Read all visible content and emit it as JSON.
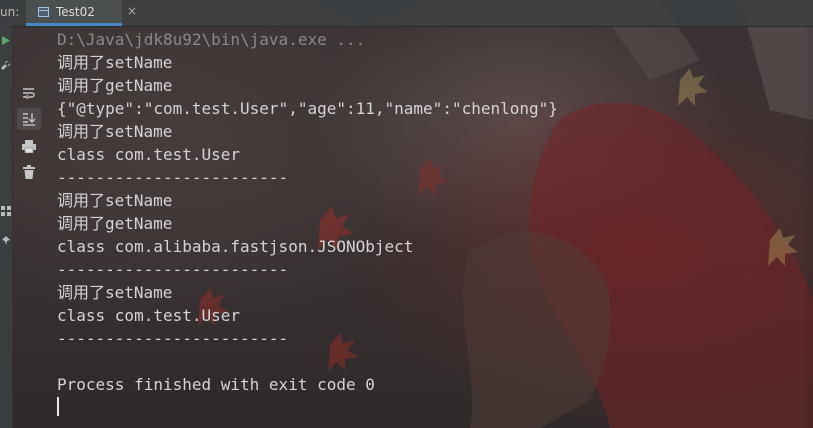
{
  "run_panel": {
    "label": "un:",
    "tab": {
      "label": "Test02",
      "close": "×"
    }
  },
  "toolbar": {
    "tools": [
      {
        "name": "soft-wrap-icon"
      },
      {
        "name": "scroll-to-end-icon",
        "active": true
      },
      {
        "name": "print-icon"
      },
      {
        "name": "trash-icon"
      }
    ],
    "gutter_icons": [
      "run-icon",
      "wrench-icon",
      "layout-icon",
      "pin-icon"
    ]
  },
  "console": {
    "lines": [
      {
        "text": "D:\\Java\\jdk8u92\\bin\\java.exe ...",
        "style": "dim"
      },
      {
        "text": "调用了setName"
      },
      {
        "text": "调用了getName"
      },
      {
        "text": "{\"@type\":\"com.test.User\",\"age\":11,\"name\":\"chenlong\"}"
      },
      {
        "text": "调用了setName"
      },
      {
        "text": "class com.test.User"
      },
      {
        "text": "------------------------"
      },
      {
        "text": "调用了setName"
      },
      {
        "text": "调用了getName"
      },
      {
        "text": "class com.alibaba.fastjson.JSONObject"
      },
      {
        "text": "------------------------"
      },
      {
        "text": "调用了setName"
      },
      {
        "text": "class com.test.User"
      },
      {
        "text": "------------------------"
      },
      {
        "text": ""
      },
      {
        "text": "Process finished with exit code 0"
      }
    ]
  },
  "colors": {
    "text": "#d4d4d4",
    "dim_text": "#8a8a8a",
    "tab_accent": "#4a88c7",
    "run_green": "#59a869"
  }
}
